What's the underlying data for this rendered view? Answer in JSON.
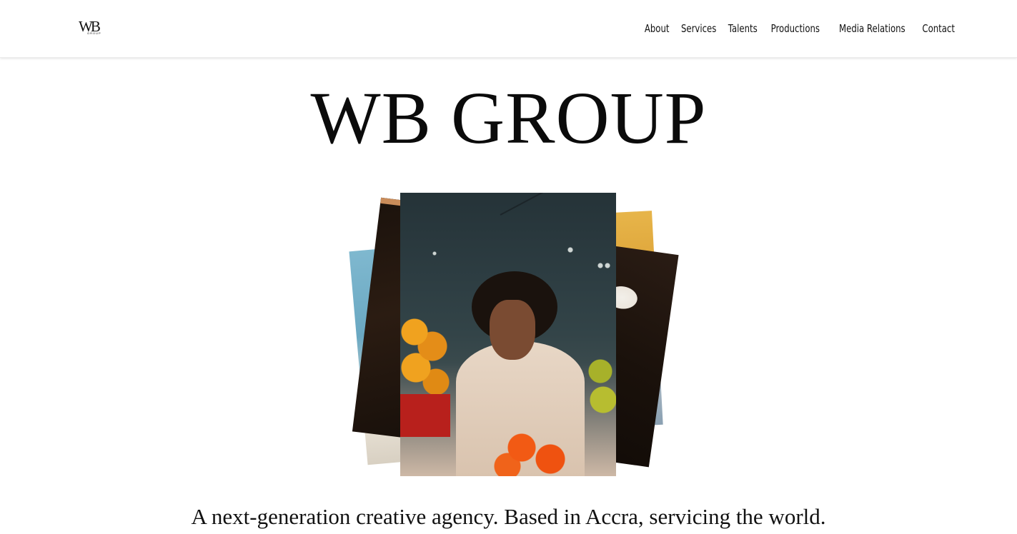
{
  "header": {
    "logo_text": "WB",
    "logo_subtext": "GROUP",
    "nav": [
      {
        "label": "About"
      },
      {
        "label": "Services"
      },
      {
        "label": "Talents"
      },
      {
        "label": "Productions"
      },
      {
        "label": "Media Relations"
      },
      {
        "label": "Contact"
      }
    ]
  },
  "hero": {
    "title": "WB GROUP",
    "tagline": "A next-generation creative agency. Based in Accra, servicing the world."
  },
  "colors": {
    "background": "#ffffff",
    "text": "#111111"
  }
}
